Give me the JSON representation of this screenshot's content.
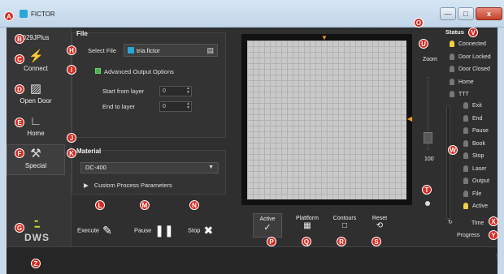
{
  "window": {
    "title": "FICTOR",
    "min_label": "—",
    "max_label": "□",
    "close_label": "x"
  },
  "markers": [
    "A",
    "B",
    "C",
    "D",
    "E",
    "F",
    "G",
    "H",
    "I",
    "J",
    "K",
    "L",
    "M",
    "N",
    "O",
    "P",
    "Q",
    "R",
    "S",
    "T",
    "U",
    "V",
    "W",
    "X",
    "Y",
    "Z"
  ],
  "sidebar": {
    "printer_name": "029JPlus",
    "connect": "Connect",
    "open_door": "Open Door",
    "home": "Home",
    "special": "Special",
    "logo_text": "DWS"
  },
  "file_panel": {
    "title": "File",
    "select_file_label": "Select File",
    "file_name": "tria.fictor",
    "advanced_label": "Advanced Output Options",
    "start_layer_label": "Start from layer",
    "start_layer_value": "0",
    "end_layer_label": "End to layer",
    "end_layer_value": "0"
  },
  "material_panel": {
    "title": "Material",
    "material_value": "DC-400",
    "custom_params": "Custom Process Parameters"
  },
  "actions": {
    "execute": "Execute",
    "pause": "Pause",
    "stop": "Stop"
  },
  "view_toggles": {
    "active": "Active",
    "platform": "Plattform",
    "contours": "Contours",
    "reset": "Reset"
  },
  "zoom": {
    "label": "Zoom",
    "value": "100"
  },
  "status": {
    "title": "Status",
    "items": [
      {
        "label": "Connected",
        "on": true
      },
      {
        "label": "Door Locked",
        "on": false
      },
      {
        "label": "Door Closed",
        "on": false
      },
      {
        "label": "Home",
        "on": false
      },
      {
        "label": "TTT",
        "on": false
      }
    ],
    "sub_items": [
      {
        "label": "Exit",
        "on": false
      },
      {
        "label": "End",
        "on": false
      },
      {
        "label": "Pause",
        "on": false
      },
      {
        "label": "Book",
        "on": false
      },
      {
        "label": "Stop",
        "on": false
      },
      {
        "label": "Laser",
        "on": false
      },
      {
        "label": "Output",
        "on": false
      },
      {
        "label": "File",
        "on": false
      },
      {
        "label": "Active",
        "on": true
      }
    ],
    "time_label": "Time",
    "progress_label": "Progress"
  },
  "colors": {
    "accent": "#2aa7d8",
    "marker": "#d82a1f",
    "status_on": "#f2d043",
    "check": "#49b34a"
  }
}
